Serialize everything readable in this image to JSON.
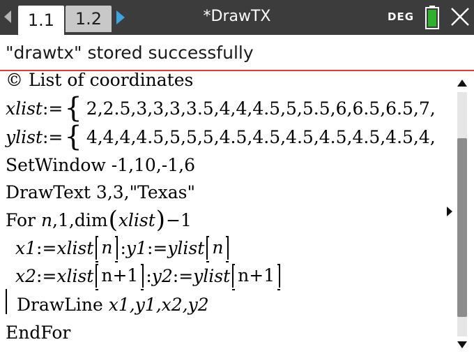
{
  "tabs": [
    {
      "label": "1.1",
      "active": true
    },
    {
      "label": "1.2",
      "active": false
    }
  ],
  "document": {
    "title": "*DrawTX"
  },
  "status_bar": {
    "angle_mode": "DEG",
    "battery_color": "#2fb02f"
  },
  "message": "\"drawtx\" stored successfully",
  "colors": {
    "tab_arrow_accent": "#3aa6e0",
    "message_underline": "#e33b3b",
    "topbar": "#3c3c3c"
  },
  "program": {
    "comment": "© List of coordinates",
    "xlist_name": "xlist",
    "xlist_op": ":=",
    "xlist_values": "2,2.5,3,3,3,3.5,4,4,4.5,5,5.5,6,6.5,6.5,7,",
    "ylist_name": "ylist",
    "ylist_op": ":=",
    "ylist_values": "4,4,4,4.5,5,5,5,4.5,4.5,4.5,4.5,4.5,4.5,4,",
    "setwindow": "SetWindow -1,10,-1,6",
    "drawtext": "DrawText 3,3,\"Texas\"",
    "for_kw": "For",
    "for_var": "n",
    "for_mid": ",1,dim",
    "for_arg": "xlist",
    "for_end": "−1",
    "line_x1": {
      "lhs": "x1",
      "op": ":=",
      "list": "xlist",
      "idx": "n",
      "sep": ":",
      "lhs2": "y1",
      "op2": ":=",
      "list2": "ylist",
      "idx2": "n"
    },
    "line_x2": {
      "lhs": "x2",
      "op": ":=",
      "list": "xlist",
      "idx": "n+1",
      "sep": ":",
      "lhs2": "y2",
      "op2": ":=",
      "list2": "ylist",
      "idx2": "n+1"
    },
    "drawline_kw": "DrawLine",
    "drawline_args": "x1,y1,x2,y2",
    "endfor": "EndFor"
  }
}
